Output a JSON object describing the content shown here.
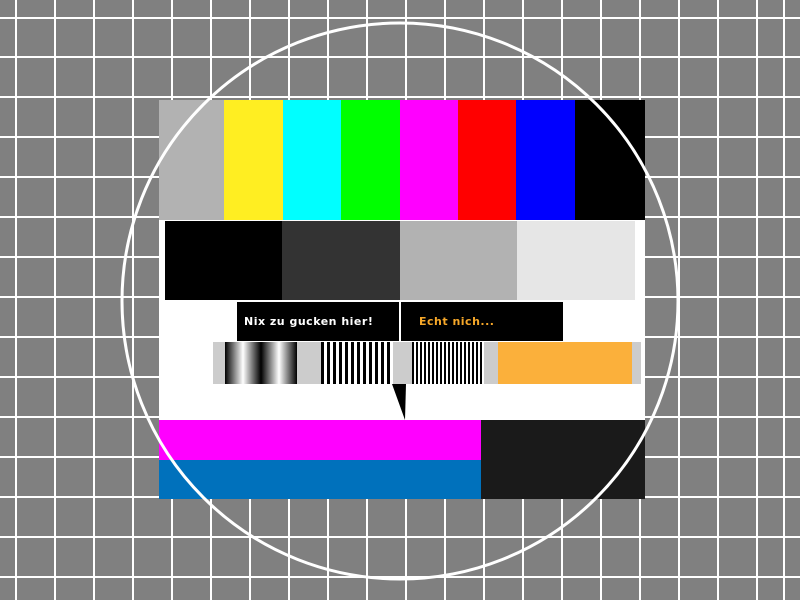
{
  "test_card": {
    "caption_left": "Nix zu gucken hier!",
    "caption_right": "Echt nich...",
    "colors": {
      "background_grid": "#808080",
      "grid_lines": "#ffffff",
      "circle": "#ffffff",
      "bar_gray": "#b2b2b2",
      "bar_yellow": "#ffee22",
      "bar_cyan": "#00ffff",
      "bar_green": "#00ff00",
      "bar_magenta": "#ff00ff",
      "bar_red": "#ff0000",
      "bar_blue": "#0000ff",
      "bar_black": "#000000",
      "gray_black": "#000000",
      "gray_dark": "#333333",
      "gray_mid": "#b2b2b2",
      "gray_light": "#e6e6e6",
      "caption_bg": "#000000",
      "caption_left_text": "#ffffff",
      "caption_right_text": "#f7a829",
      "orange_block": "#fbb03b",
      "bottom_magenta": "#ff00ff",
      "bottom_blue": "#0071bc",
      "bottom_dark": "#1a1a1a"
    }
  }
}
